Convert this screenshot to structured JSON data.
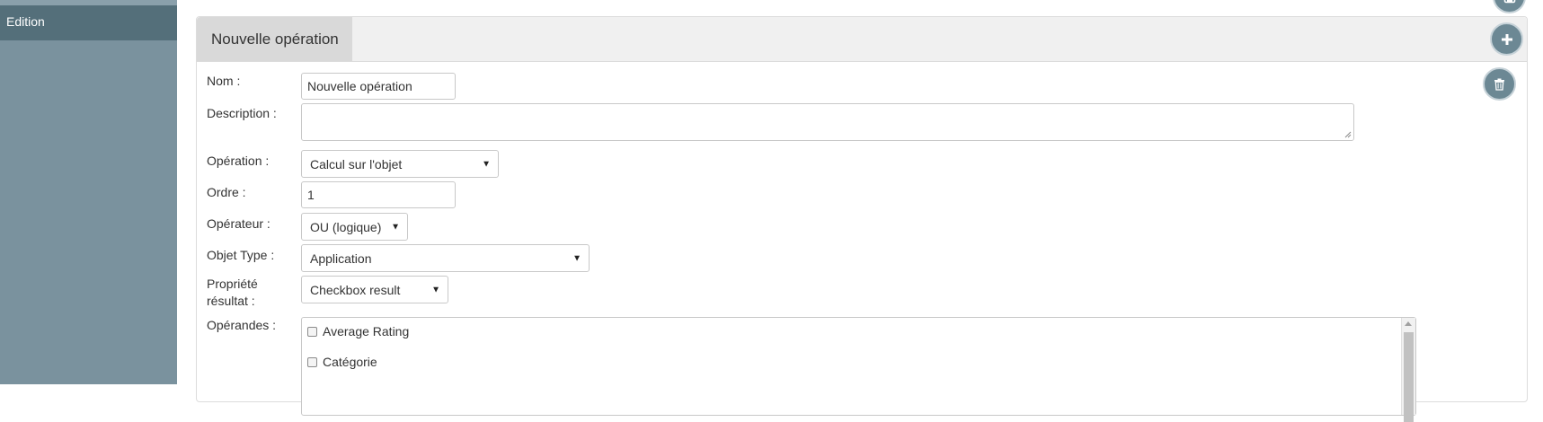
{
  "sidebar": {
    "items": [
      {
        "label": "Edition"
      }
    ]
  },
  "panel": {
    "title": "Nouvelle opération"
  },
  "form": {
    "nom": {
      "label": "Nom :",
      "value": "Nouvelle opération"
    },
    "description": {
      "label": "Description :",
      "value": ""
    },
    "operation": {
      "label": "Opération :",
      "value": "Calcul sur l'objet"
    },
    "ordre": {
      "label": "Ordre :",
      "value": "1"
    },
    "operateur": {
      "label": "Opérateur :",
      "value": "OU (logique)"
    },
    "objet_type": {
      "label": "Objet Type :",
      "value": "Application"
    },
    "propriete": {
      "label_line1": "Propriété",
      "label_line2": "résultat :",
      "value": "Checkbox result"
    },
    "operandes": {
      "label": "Opérandes :",
      "items": [
        {
          "label": "Average Rating",
          "checked": false
        },
        {
          "label": "Catégorie",
          "checked": false
        }
      ]
    }
  },
  "icons": {
    "add": "plus-icon",
    "delete": "trash-icon",
    "save": "save-icon",
    "dropdown": "caret-down-icon"
  },
  "colors": {
    "sidebar": "#7a929e",
    "sidebar_active": "#546f7a",
    "round_button": "#6c8894"
  }
}
